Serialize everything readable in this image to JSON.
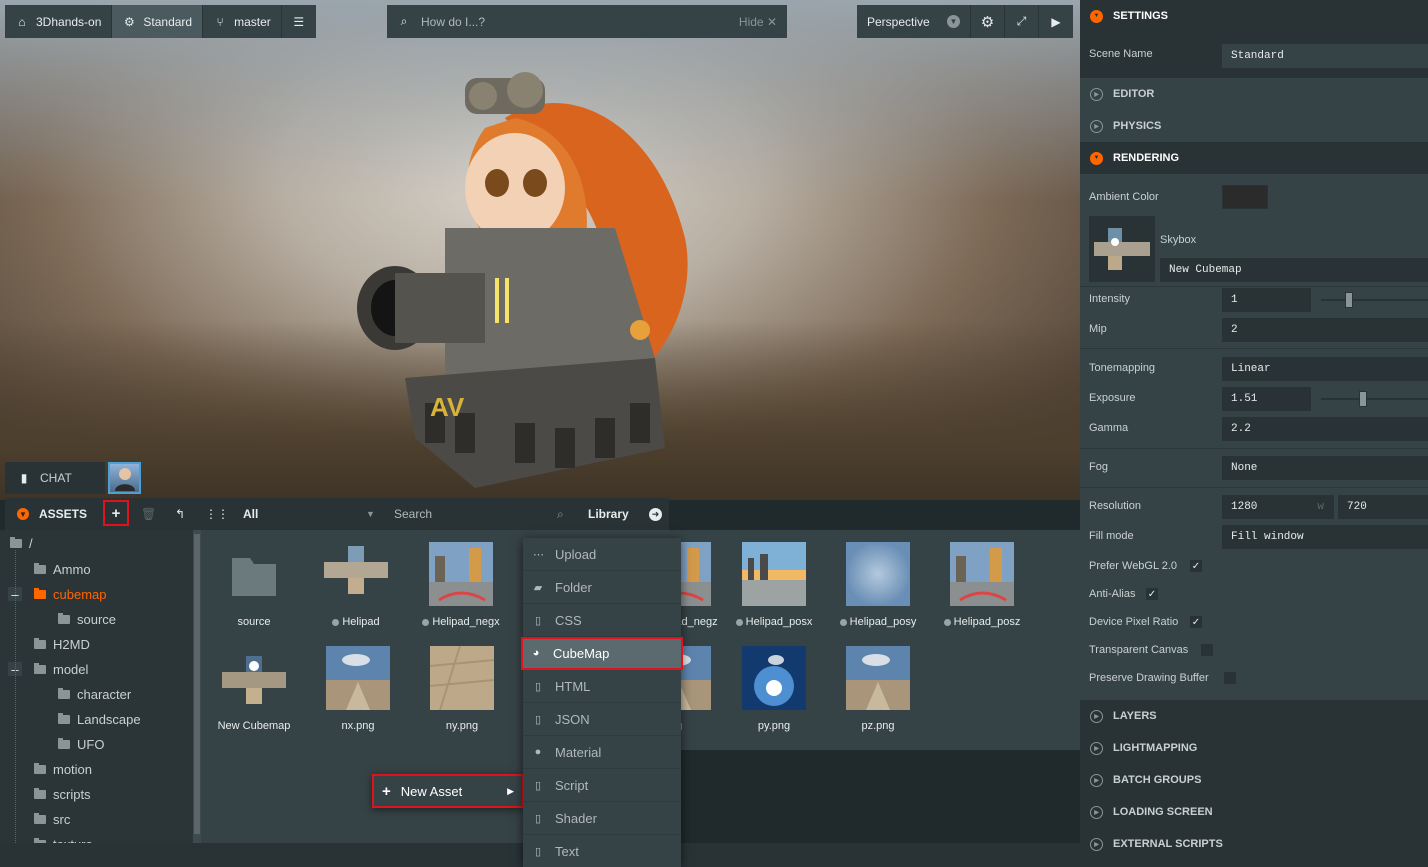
{
  "toolbar": {
    "project": "3Dhands-on",
    "scene": "Standard",
    "branch": "master",
    "search_placeholder": "How do I...?",
    "search_hide": "Hide",
    "camera": "Perspective"
  },
  "chat": {
    "label": "CHAT"
  },
  "assets": {
    "title": "ASSETS",
    "filter": "All",
    "search_placeholder": "Search",
    "library": "Library",
    "tree": [
      {
        "label": "/",
        "level": 0
      },
      {
        "label": "Ammo",
        "level": 1
      },
      {
        "label": "cubemap",
        "level": 1,
        "active": true
      },
      {
        "label": "source",
        "level": 2
      },
      {
        "label": "H2MD",
        "level": 1
      },
      {
        "label": "model",
        "level": 1
      },
      {
        "label": "character",
        "level": 2
      },
      {
        "label": "Landscape",
        "level": 2
      },
      {
        "label": "UFO",
        "level": 2
      },
      {
        "label": "motion",
        "level": 1
      },
      {
        "label": "scripts",
        "level": 1
      },
      {
        "label": "src",
        "level": 1
      },
      {
        "label": "texture",
        "level": 1
      }
    ],
    "items": [
      {
        "label": "source",
        "kind": "folder"
      },
      {
        "label": "Helipad",
        "kind": "cubemap"
      },
      {
        "label": "Helipad_negx",
        "kind": "city"
      },
      {
        "label": "Helipad_negz",
        "kind": "city"
      },
      {
        "label": "Helipad_posx",
        "kind": "sunset"
      },
      {
        "label": "Helipad_posy",
        "kind": "sky"
      },
      {
        "label": "Helipad_posz",
        "kind": "city"
      },
      {
        "label": "New Cubemap",
        "kind": "cubemap2"
      },
      {
        "label": "nx.png",
        "kind": "desert"
      },
      {
        "label": "ny.png",
        "kind": "sand"
      },
      {
        "label": "g",
        "kind": "desert"
      },
      {
        "label": "py.png",
        "kind": "blue"
      },
      {
        "label": "pz.png",
        "kind": "desert"
      }
    ]
  },
  "context_menu": {
    "new_asset": "New Asset",
    "items": [
      "Upload",
      "Folder",
      "CSS",
      "CubeMap",
      "HTML",
      "JSON",
      "Material",
      "Script",
      "Shader",
      "Text"
    ],
    "selected": "CubeMap"
  },
  "settings": {
    "title": "SETTINGS",
    "scene_name_label": "Scene Name",
    "scene_name": "Standard",
    "sections_top": [
      "EDITOR",
      "PHYSICS"
    ],
    "rendering": "RENDERING",
    "ambient_color_label": "Ambient Color",
    "skybox_label": "Skybox",
    "skybox_value": "New Cubemap",
    "intensity_label": "Intensity",
    "intensity": "1",
    "mip_label": "Mip",
    "mip": "2",
    "tonemapping_label": "Tonemapping",
    "tonemapping": "Linear",
    "exposure_label": "Exposure",
    "exposure": "1.51",
    "gamma_label": "Gamma",
    "gamma": "2.2",
    "fog_label": "Fog",
    "fog": "None",
    "resolution_label": "Resolution",
    "res_w": "1280",
    "res_w_unit": "w",
    "res_h": "720",
    "fill_mode_label": "Fill mode",
    "fill_mode": "Fill window",
    "webgl2_label": "Prefer WebGL 2.0",
    "antialias_label": "Anti-Alias",
    "dpr_label": "Device Pixel Ratio",
    "transparent_label": "Transparent Canvas",
    "preserve_label": "Preserve Drawing Buffer",
    "sections_bottom": [
      "LAYERS",
      "LIGHTMAPPING",
      "BATCH GROUPS",
      "LOADING SCREEN",
      "EXTERNAL SCRIPTS"
    ],
    "colors": {
      "accent": "#ff6600",
      "highlight": "#e0121b"
    }
  }
}
